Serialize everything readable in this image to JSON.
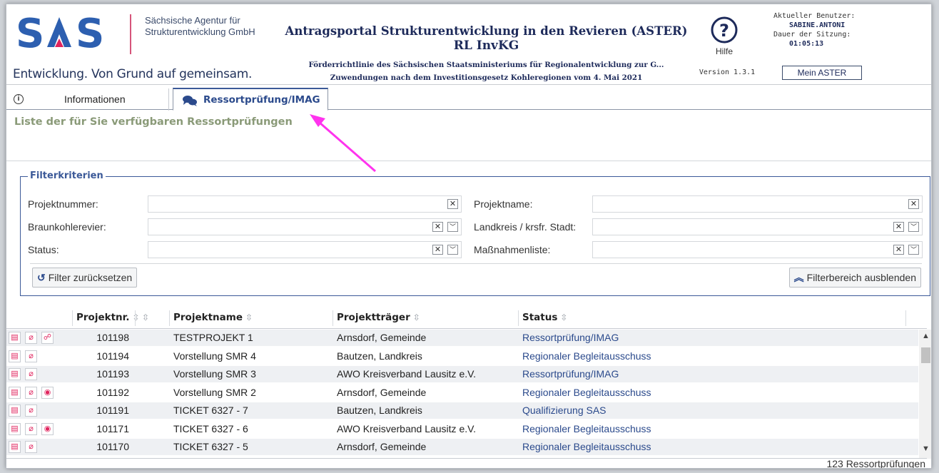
{
  "header": {
    "logo_text": "SAS",
    "agency_line1": "Sächsische Agentur für",
    "agency_line2": "Strukturentwicklung GmbH",
    "slogan": "Entwicklung. Von Grund auf gemeinsam.",
    "title_line1": "Antragsportal Strukturentwicklung in den Revieren (ASTER)",
    "title_line2": "RL InvKG",
    "desc_line1": "Förderrichtlinie des Sächsischen Staatsministeriums für Regionalentwicklung zur G...",
    "desc_line2": "Zuwendungen nach dem Investitionsgesetz Kohleregionen vom 4. Mai 2021",
    "help_label": "Hilfe",
    "version": "Version 1.3.1",
    "user_label": "Aktueller Benutzer:",
    "user_name": "SABINE.ANTONI",
    "session_label": "Dauer der Sitzung:",
    "session_time": "01:05:13",
    "mein_aster": "Mein ASTER"
  },
  "tabs": [
    {
      "label": "Informationen",
      "icon": "info-icon",
      "active": false
    },
    {
      "label": "Ressortprüfung/IMAG",
      "icon": "chat-icon",
      "active": true
    }
  ],
  "list_title": "Liste der für Sie verfügbaren Ressortprüfungen",
  "filter": {
    "legend": "Filterkriterien",
    "projektnummer_label": "Projektnummer:",
    "projektname_label": "Projektname:",
    "braunkohlerevier_label": "Braunkohlerevier:",
    "landkreis_label": "Landkreis / krsfr. Stadt:",
    "status_label": "Status:",
    "massnahmen_label": "Maßnahmenliste:",
    "reset_button": "Filter zurücksetzen",
    "hide_button": "Filterbereich ausblenden"
  },
  "table": {
    "columns": [
      "Projektnr.",
      "Projektname",
      "Projektträger",
      "Status"
    ],
    "rows": [
      {
        "nr": "101198",
        "name": "TESTPROJEKT 1",
        "traeger": "Arnsdorf, Gemeinde",
        "status": "Ressortprüfung/IMAG",
        "icons": [
          "doc",
          "clip",
          "chat"
        ]
      },
      {
        "nr": "101194",
        "name": "Vorstellung SMR 4",
        "traeger": "Bautzen, Landkreis",
        "status": "Regionaler Begleitausschuss",
        "icons": [
          "doc",
          "clip"
        ]
      },
      {
        "nr": "101193",
        "name": "Vorstellung SMR 3",
        "traeger": "AWO Kreisverband Lausitz e.V.",
        "status": "Ressortprüfung/IMAG",
        "icons": [
          "doc",
          "clip"
        ]
      },
      {
        "nr": "101192",
        "name": "Vorstellung SMR 2",
        "traeger": "Arnsdorf, Gemeinde",
        "status": "Regionaler Begleitausschuss",
        "icons": [
          "doc",
          "clip",
          "eye"
        ]
      },
      {
        "nr": "101191",
        "name": "TICKET 6327 - 7",
        "traeger": "Bautzen, Landkreis",
        "status": "Qualifizierung SAS",
        "icons": [
          "doc",
          "clip"
        ]
      },
      {
        "nr": "101171",
        "name": "TICKET 6327 - 6",
        "traeger": "AWO Kreisverband Lausitz e.V.",
        "status": "Regionaler Begleitausschuss",
        "icons": [
          "doc",
          "clip",
          "eye"
        ]
      },
      {
        "nr": "101170",
        "name": "TICKET 6327 - 5",
        "traeger": "Arnsdorf, Gemeinde",
        "status": "Regionaler Begleitausschuss",
        "icons": [
          "doc",
          "clip"
        ]
      }
    ],
    "count": "123 Ressortprüfungen"
  },
  "colors": {
    "brand_blue": "#3b5998",
    "accent_pink": "#e0245e",
    "annotation_arrow": "#ff33ee"
  }
}
